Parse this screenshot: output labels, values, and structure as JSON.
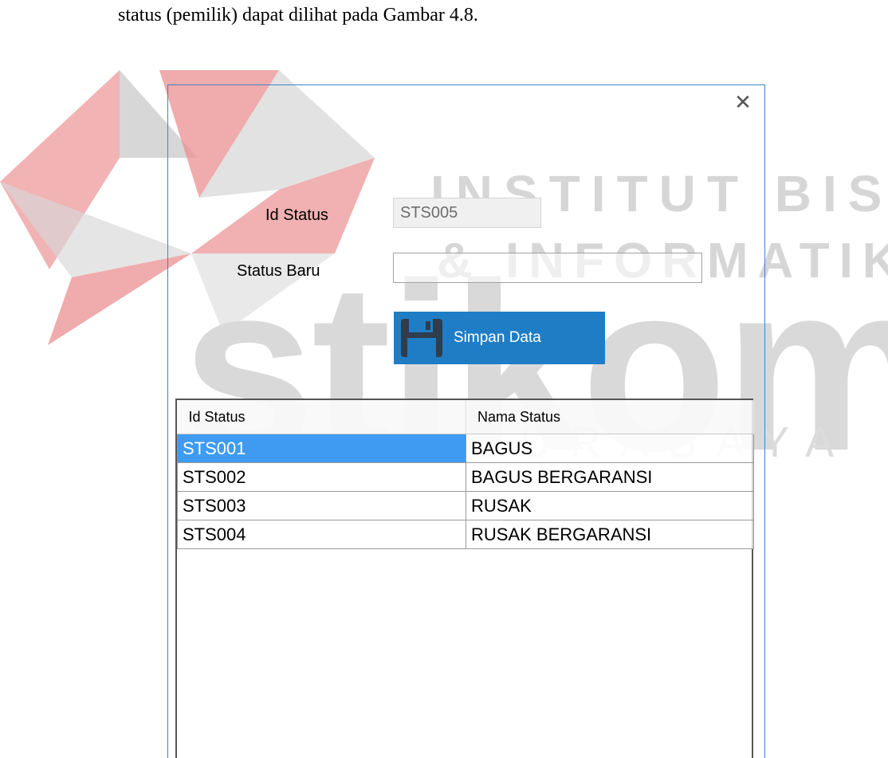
{
  "document": {
    "intro_text": "status (pemilik) dapat dilihat pada Gambar 4.8."
  },
  "watermark": {
    "line1": "INSTITUT BISNIS",
    "line2": "& INFORMATIKA",
    "brand": "stikom",
    "city": "SURABAYA"
  },
  "window": {
    "close_glyph": "✕"
  },
  "form": {
    "id_label": "Id Status",
    "id_value": "STS005",
    "new_label": "Status Baru",
    "new_value": "",
    "save_label": "Simpan Data"
  },
  "grid": {
    "headers": [
      "Id Status",
      "Nama Status"
    ],
    "rows": [
      {
        "id": "STS001",
        "name": "BAGUS",
        "selected": true
      },
      {
        "id": "STS002",
        "name": "BAGUS BERGARANSI",
        "selected": false
      },
      {
        "id": "STS003",
        "name": "RUSAK",
        "selected": false
      },
      {
        "id": "STS004",
        "name": "RUSAK BERGARANSI",
        "selected": false
      }
    ]
  },
  "colors": {
    "accent": "#1f7dc6",
    "selection": "#3e9bf1",
    "window_border": "#3d84c8",
    "watermark_red": "#e97f80"
  },
  "icons": {
    "save": "floppy-disk-icon",
    "close": "close-icon"
  }
}
